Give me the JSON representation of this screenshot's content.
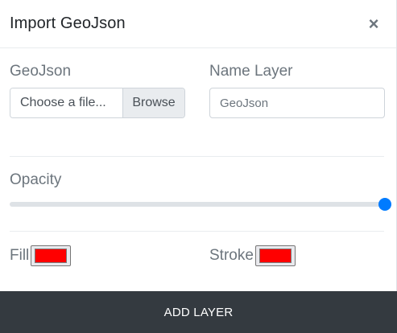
{
  "dialog": {
    "title": "Import GeoJson",
    "close_glyph": "×"
  },
  "geojson": {
    "label": "GeoJson",
    "file_placeholder": "Choose a file...",
    "browse_label": "Browse"
  },
  "name_layer": {
    "label": "Name Layer",
    "placeholder": "GeoJson",
    "value": ""
  },
  "opacity": {
    "label": "Opacity",
    "value": 1.0
  },
  "fill": {
    "label": "Fill",
    "color": "#ff0000"
  },
  "stroke": {
    "label": "Stroke",
    "color": "#ff0000"
  },
  "footer": {
    "button_label": "ADD LAYER"
  },
  "theme": {
    "accent": "#007bff",
    "footer_bg": "#343a40"
  }
}
